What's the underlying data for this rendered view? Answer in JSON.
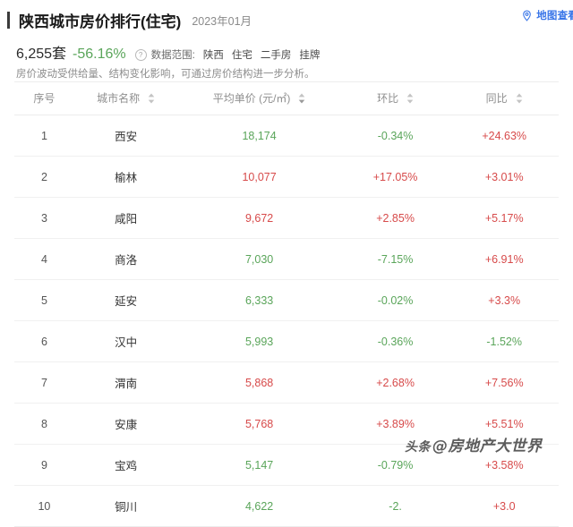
{
  "header": {
    "title": "陕西城市房价排行(住宅)",
    "date": "2023年01月",
    "map_link_label": "地图查看",
    "map_icon": "location-pin-icon"
  },
  "stats": {
    "count": "6,255套",
    "change": "-56.16%",
    "change_direction": "down",
    "help_icon": "question-mark-icon",
    "scope_label": "数据范围:",
    "scope_tags": [
      "陕西",
      "住宅",
      "二手房",
      "挂牌"
    ],
    "description": "房价波动受供给量、结构变化影响，可通过房价结构进一步分析。"
  },
  "table": {
    "columns": [
      {
        "label": "序号",
        "sortable": false
      },
      {
        "label": "城市名称",
        "sortable": true
      },
      {
        "label": "平均单价 (元/㎡)",
        "sortable": true
      },
      {
        "label": "环比",
        "sortable": true
      },
      {
        "label": "同比",
        "sortable": true
      }
    ],
    "rows": [
      {
        "idx": "1",
        "city": "西安",
        "price": "18,174",
        "price_dir": "down",
        "mom": "-0.34%",
        "mom_dir": "down",
        "yoy": "+24.63%",
        "yoy_dir": "up"
      },
      {
        "idx": "2",
        "city": "榆林",
        "price": "10,077",
        "price_dir": "up",
        "mom": "+17.05%",
        "mom_dir": "up",
        "yoy": "+3.01%",
        "yoy_dir": "up"
      },
      {
        "idx": "3",
        "city": "咸阳",
        "price": "9,672",
        "price_dir": "up",
        "mom": "+2.85%",
        "mom_dir": "up",
        "yoy": "+5.17%",
        "yoy_dir": "up"
      },
      {
        "idx": "4",
        "city": "商洛",
        "price": "7,030",
        "price_dir": "down",
        "mom": "-7.15%",
        "mom_dir": "down",
        "yoy": "+6.91%",
        "yoy_dir": "up"
      },
      {
        "idx": "5",
        "city": "延安",
        "price": "6,333",
        "price_dir": "down",
        "mom": "-0.02%",
        "mom_dir": "down",
        "yoy": "+3.3%",
        "yoy_dir": "up"
      },
      {
        "idx": "6",
        "city": "汉中",
        "price": "5,993",
        "price_dir": "down",
        "mom": "-0.36%",
        "mom_dir": "down",
        "yoy": "-1.52%",
        "yoy_dir": "down"
      },
      {
        "idx": "7",
        "city": "渭南",
        "price": "5,868",
        "price_dir": "up",
        "mom": "+2.68%",
        "mom_dir": "up",
        "yoy": "+7.56%",
        "yoy_dir": "up"
      },
      {
        "idx": "8",
        "city": "安康",
        "price": "5,768",
        "price_dir": "up",
        "mom": "+3.89%",
        "mom_dir": "up",
        "yoy": "+5.51%",
        "yoy_dir": "up"
      },
      {
        "idx": "9",
        "city": "宝鸡",
        "price": "5,147",
        "price_dir": "down",
        "mom": "-0.79%",
        "mom_dir": "down",
        "yoy": "+3.58%",
        "yoy_dir": "up"
      },
      {
        "idx": "10",
        "city": "铜川",
        "price": "4,622",
        "price_dir": "down",
        "mom": "-2.",
        "mom_dir": "down",
        "yoy": "+3.0",
        "yoy_dir": "up"
      }
    ]
  },
  "watermark": {
    "tag": "头条",
    "handle": "@房地产大世界"
  },
  "colors": {
    "up": "#d74a4a",
    "down": "#5aa55a",
    "link": "#3a76e8",
    "title": "#1a1a1a"
  }
}
